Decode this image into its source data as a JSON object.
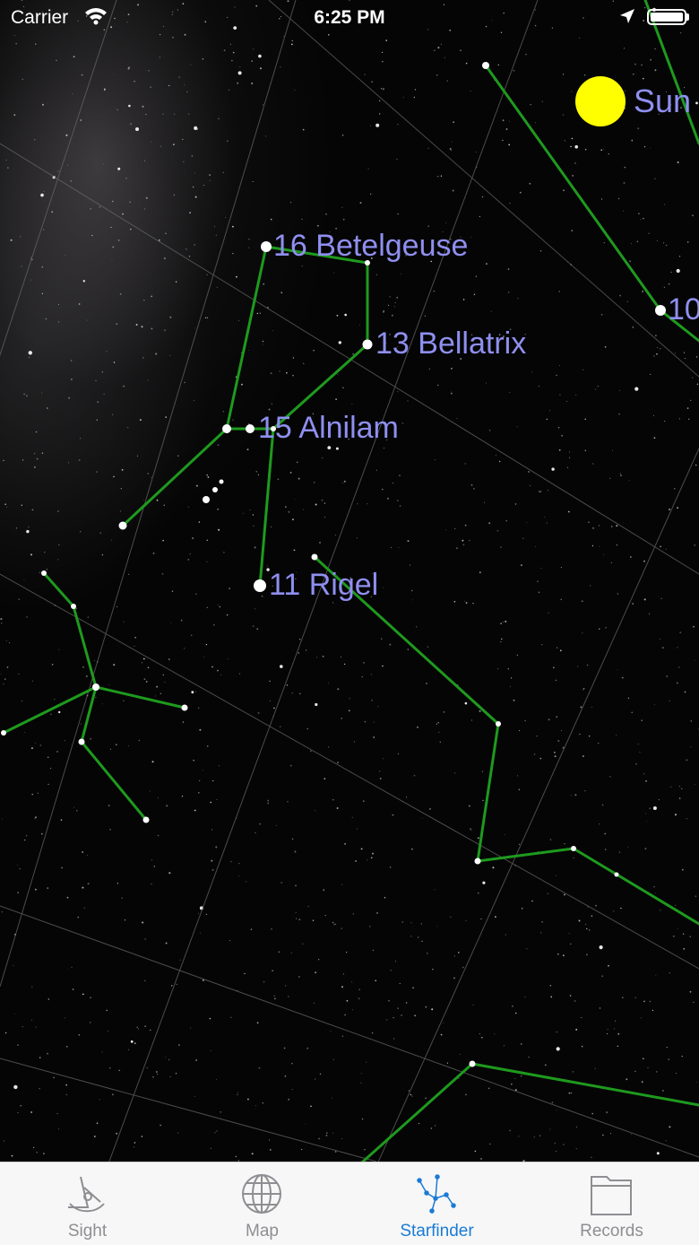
{
  "status_bar": {
    "carrier": "Carrier",
    "time": "6:25 PM"
  },
  "sky": {
    "sun_label": "Sun",
    "stars": {
      "betelgeuse": "16 Betelgeuse",
      "bellatrix": "13 Bellatrix",
      "alnilam": "15 Alnilam",
      "rigel": "11 Rigel",
      "partial_right": "10"
    },
    "colors": {
      "label": "#8f8ff0",
      "constellation": "#1e9a1e",
      "sun": "#ffff00",
      "grid": "#6a6a6a"
    }
  },
  "tabbar": {
    "tabs": [
      {
        "label": "Sight",
        "icon": "sextant-icon",
        "active": false
      },
      {
        "label": "Map",
        "icon": "globe-icon",
        "active": false
      },
      {
        "label": "Starfinder",
        "icon": "constellation-icon",
        "active": true
      },
      {
        "label": "Records",
        "icon": "folder-icon",
        "active": false
      }
    ],
    "active_color": "#1a7bd6",
    "inactive_color": "#8e8e93"
  }
}
